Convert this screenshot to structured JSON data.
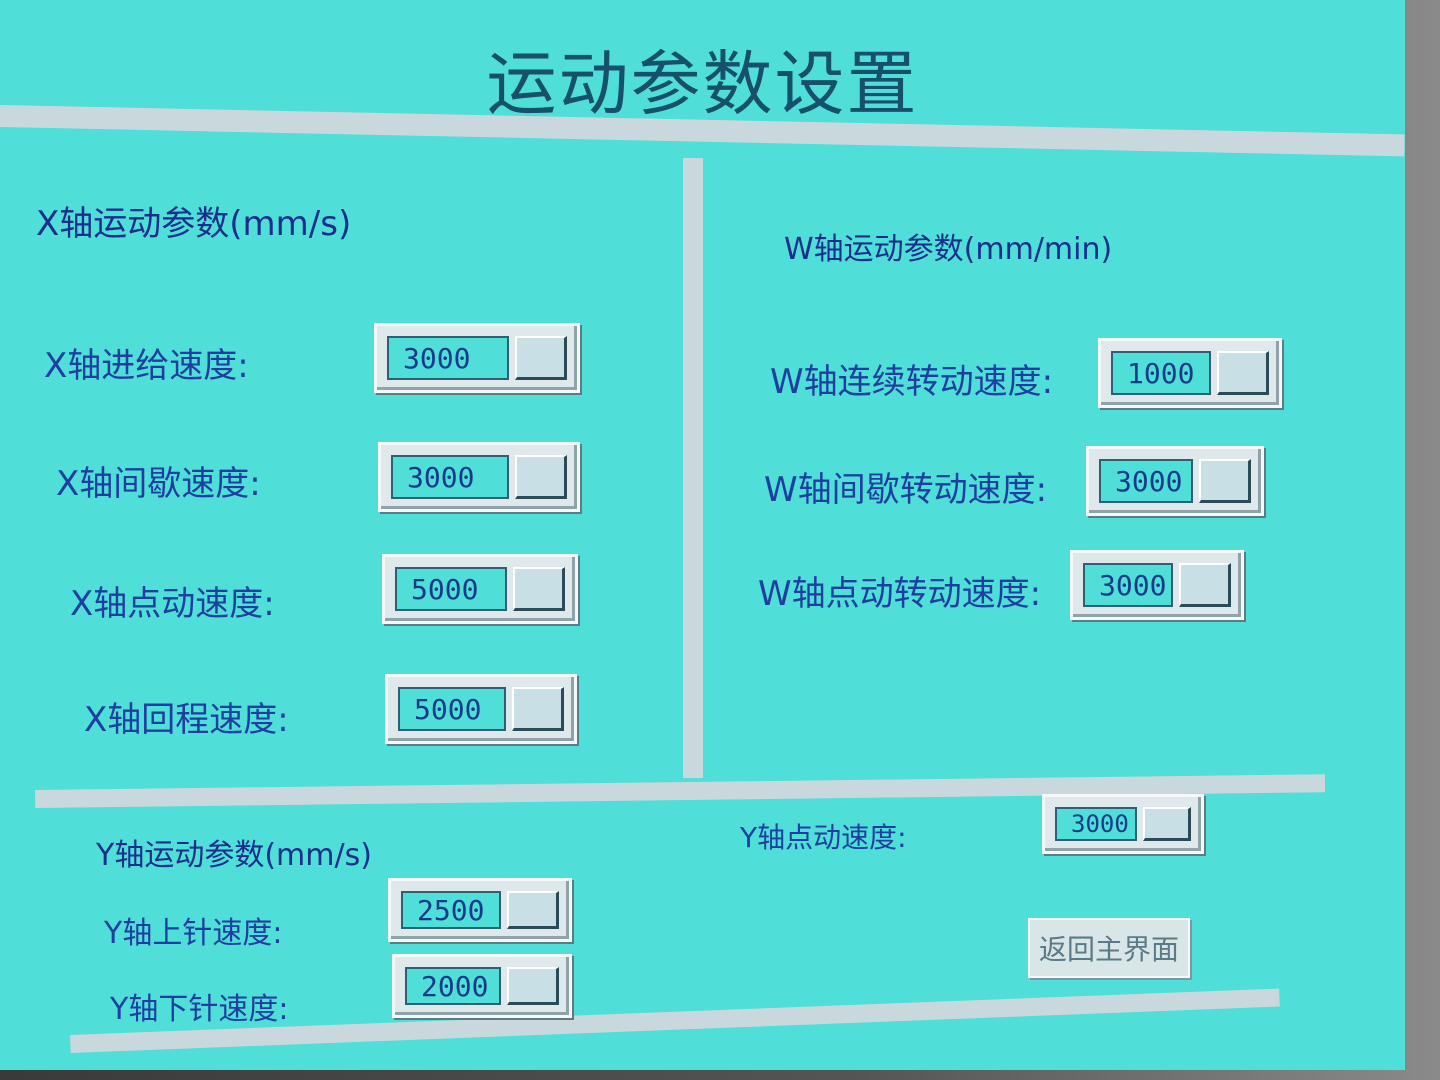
{
  "title": "运动参数设置",
  "x_axis": {
    "title": "X轴运动参数(mm/s)",
    "rows": [
      {
        "label": "X轴进给速度:",
        "value": "3000"
      },
      {
        "label": "X轴间歇速度:",
        "value": "3000"
      },
      {
        "label": "X轴点动速度:",
        "value": "5000"
      },
      {
        "label": "X轴回程速度:",
        "value": "5000"
      }
    ]
  },
  "w_axis": {
    "title": "W轴运动参数(mm/min)",
    "rows": [
      {
        "label": "W轴连续转动速度:",
        "value": "1000"
      },
      {
        "label": "W轴间歇转动速度:",
        "value": "3000"
      },
      {
        "label": "W轴点动转动速度:",
        "value": "3000"
      }
    ]
  },
  "y_axis": {
    "title": "Y轴运动参数(mm/s)",
    "rows": [
      {
        "label": "Y轴上针速度:",
        "value": "2500"
      },
      {
        "label": "Y轴下针速度:",
        "value": "2000"
      }
    ],
    "jog": {
      "label": "Y轴点动速度:",
      "value": "3000"
    }
  },
  "return_button": "返回主界面",
  "colors": {
    "background": "#4fded8",
    "divider": "#c8d8dc",
    "label_text": "#1e3fa0",
    "title_text": "#17506a"
  }
}
